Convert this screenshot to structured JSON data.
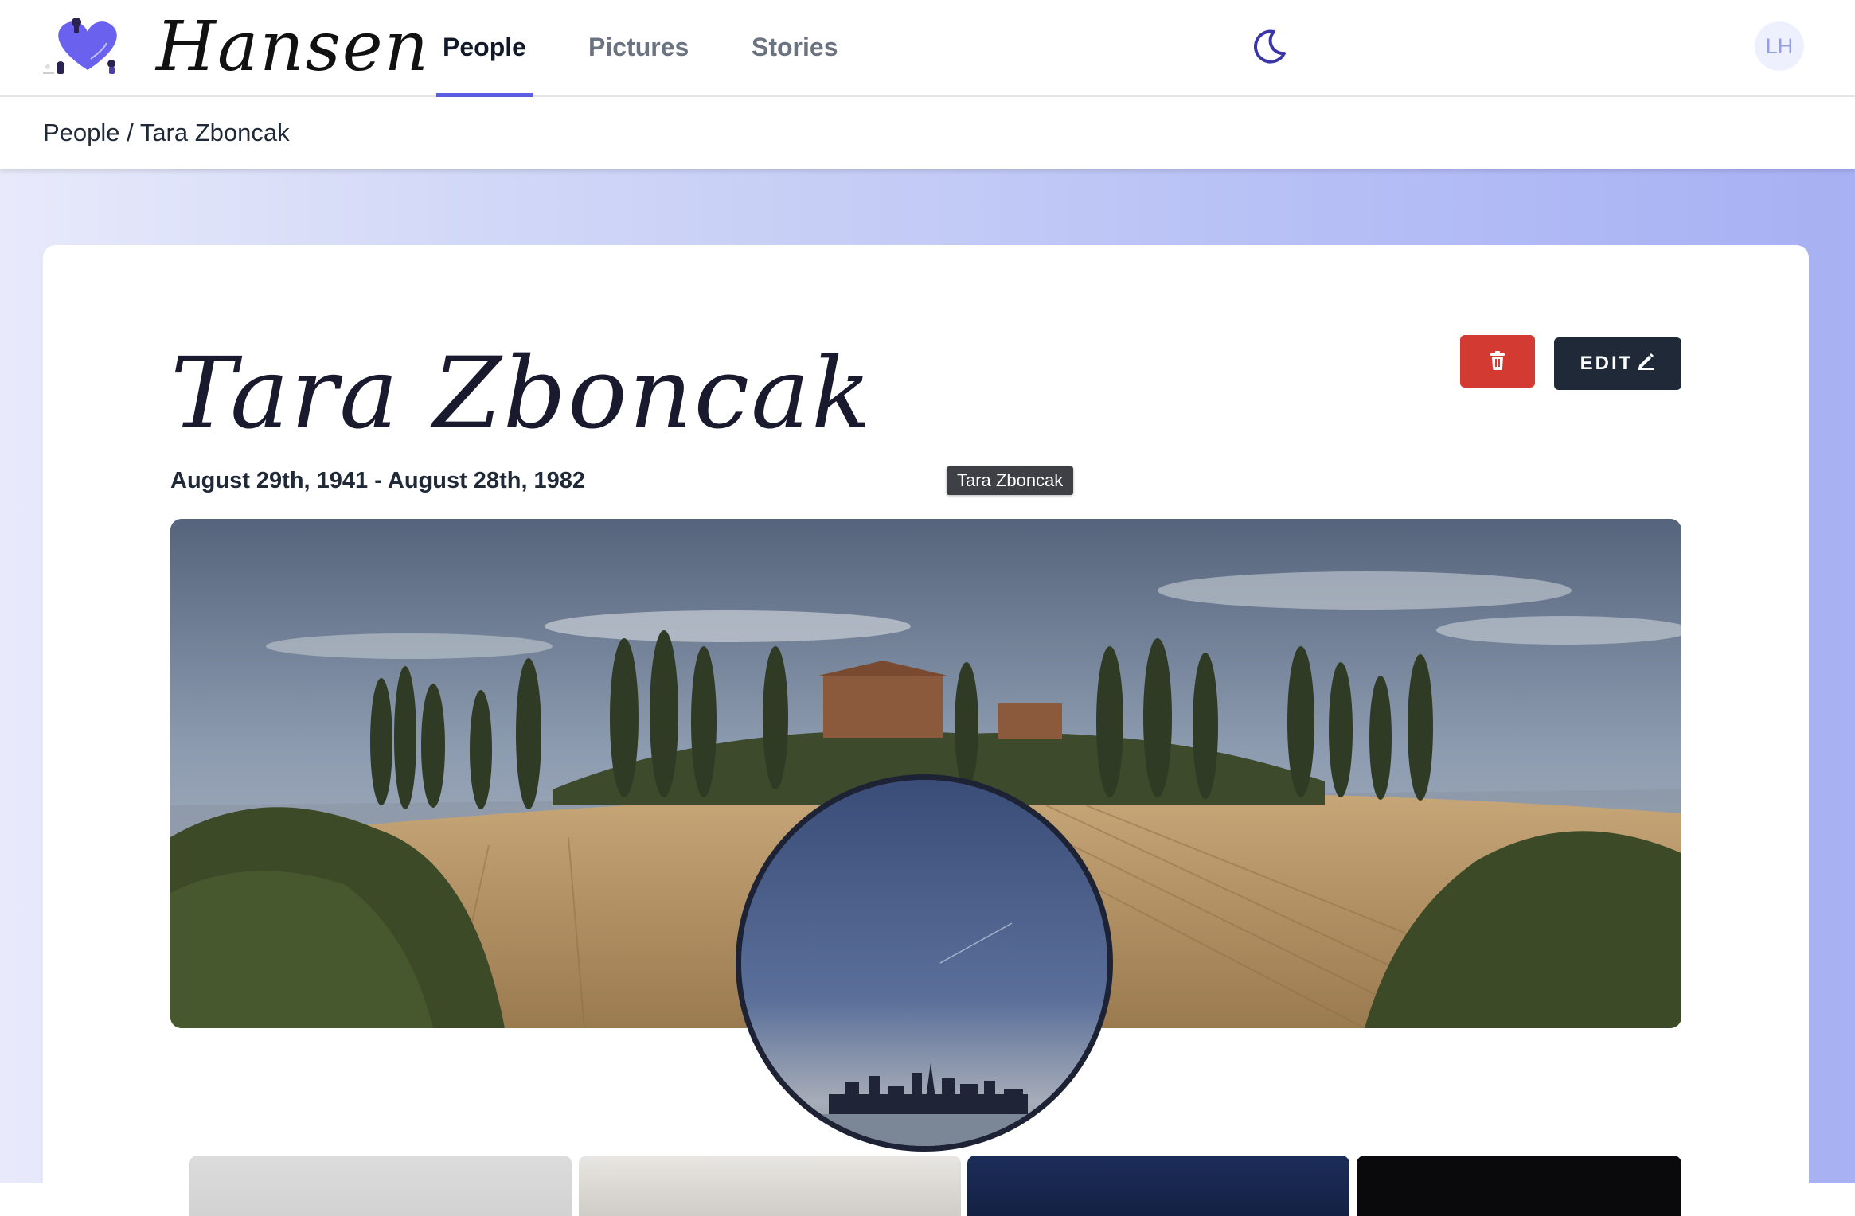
{
  "app": {
    "logo_text": "Hansen",
    "logo_icon": "heart-logo-icon"
  },
  "nav": {
    "tabs": [
      {
        "label": "People",
        "active": true
      },
      {
        "label": "Pictures",
        "active": false
      },
      {
        "label": "Stories",
        "active": false
      }
    ],
    "theme_toggle_icon": "moon-icon",
    "avatar_initials": "LH"
  },
  "breadcrumb": {
    "root": "People",
    "separator": " / ",
    "current": "Tara Zboncak"
  },
  "person": {
    "name": "Tara Zboncak",
    "dates": "August 29th, 1941 - August 28th, 1982",
    "tooltip": "Tara Zboncak"
  },
  "actions": {
    "delete_icon": "trash-icon",
    "edit_label": "EDIT",
    "edit_icon": "pencil-icon"
  },
  "colors": {
    "accent": "#5b5fe0",
    "delete": "#d33a32",
    "edit": "#1f2937",
    "gradient_start": "#e8eafb",
    "gradient_end": "#a7b1f3"
  }
}
